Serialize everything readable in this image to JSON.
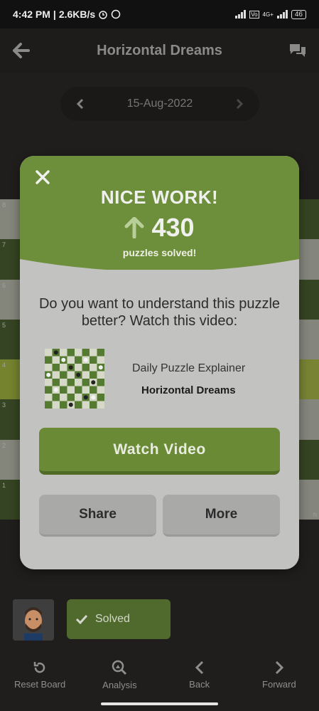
{
  "status_bar": {
    "time": "4:42 PM",
    "speed": "2.6KB/s",
    "network": "4G+",
    "battery": "46"
  },
  "app_bar": {
    "title": "Horizontal Dreams"
  },
  "date_selector": {
    "date": "15-Aug-2022"
  },
  "board": {
    "rank_labels": [
      "8",
      "7",
      "6",
      "5",
      "4",
      "3",
      "2",
      "1"
    ],
    "file_label_h": "h"
  },
  "modal": {
    "heading": "NICE WORK!",
    "score": "430",
    "score_caption": "puzzles solved!",
    "question": "Do you want to understand this puzzle better? Watch this video:",
    "video_title": "Daily Puzzle Explainer",
    "video_subtitle": "Horizontal Dreams",
    "watch_button": "Watch Video",
    "share_button": "Share",
    "more_button": "More"
  },
  "player": {
    "status": "Solved"
  },
  "toolbar": {
    "reset": "Reset Board",
    "analysis": "Analysis",
    "back": "Back",
    "forward": "Forward"
  },
  "colors": {
    "accent_green": "#6a8a35",
    "modal_bg": "#c2c2c1",
    "header_green": "#6d8e3a"
  },
  "icons": [
    "back-arrow-icon",
    "chat-icon",
    "chevron-left-icon",
    "chevron-right-icon",
    "close-icon",
    "arrow-up-icon",
    "check-icon",
    "reset-icon",
    "analysis-icon",
    "back-icon",
    "forward-icon"
  ]
}
